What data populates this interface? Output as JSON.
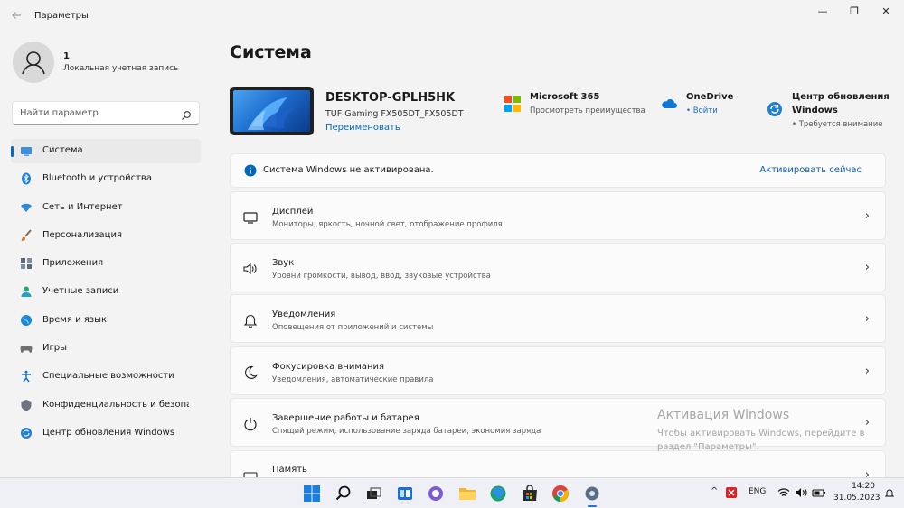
{
  "window": {
    "title": "Параметры",
    "controls": {
      "minimize": "—",
      "maximize": "❐",
      "close": "✕"
    }
  },
  "profile": {
    "name": "1",
    "account_type": "Локальная учетная запись"
  },
  "search": {
    "placeholder": "Найти параметр"
  },
  "sidebar": {
    "items": [
      {
        "label": "Система",
        "icon": "system-icon",
        "active": true
      },
      {
        "label": "Bluetooth и устройства",
        "icon": "bluetooth-icon"
      },
      {
        "label": "Сеть и Интернет",
        "icon": "wifi-icon"
      },
      {
        "label": "Персонализация",
        "icon": "brush-icon"
      },
      {
        "label": "Приложения",
        "icon": "apps-icon"
      },
      {
        "label": "Учетные записи",
        "icon": "accounts-icon"
      },
      {
        "label": "Время и язык",
        "icon": "globe-icon"
      },
      {
        "label": "Игры",
        "icon": "gamepad-icon"
      },
      {
        "label": "Специальные возможности",
        "icon": "accessibility-icon"
      },
      {
        "label": "Конфиденциальность и безопасность",
        "icon": "shield-icon"
      },
      {
        "label": "Центр обновления Windows",
        "icon": "update-icon"
      }
    ]
  },
  "main": {
    "title": "Система",
    "device": {
      "name": "DESKTOP-GPLH5HK",
      "model": "TUF Gaming FX505DT_FX505DT",
      "rename": "Переименовать"
    },
    "quick": [
      {
        "title": "Microsoft 365",
        "subtitle": "Просмотреть преимущества",
        "icon": "microsoft-365-icon"
      },
      {
        "title": "OneDrive",
        "subtitle": "• Войти",
        "icon": "onedrive-icon"
      },
      {
        "title": "Центр обновления Windows",
        "title_line1": "Центр обновления",
        "title_line2": "Windows",
        "subtitle": "• Требуется внимание",
        "icon": "windows-update-icon"
      }
    ],
    "activation": {
      "message": "Система Windows не активирована.",
      "action": "Активировать сейчас"
    },
    "settings": [
      {
        "title": "Дисплей",
        "description": "Мониторы, яркость, ночной свет, отображение профиля",
        "icon": "display-icon"
      },
      {
        "title": "Звук",
        "description": "Уровни громкости, вывод, ввод, звуковые устройства",
        "icon": "sound-icon"
      },
      {
        "title": "Уведомления",
        "description": "Оповещения от приложений и системы",
        "icon": "bell-icon"
      },
      {
        "title": "Фокусировка внимания",
        "description": "Уведомления, автоматические правила",
        "icon": "focus-icon"
      },
      {
        "title": "Завершение работы и батарея",
        "description": "Спящий режим, использование заряда батареи, экономия заряда",
        "icon": "power-icon"
      },
      {
        "title": "Память",
        "description": "",
        "icon": "storage-icon"
      }
    ]
  },
  "watermark": {
    "title": "Активация Windows",
    "line1": "Чтобы активировать Windows, перейдите в",
    "line2": "раздел \"Параметры\"."
  },
  "taskbar": {
    "apps": [
      "windows-start-icon",
      "search-icon",
      "task-view-icon",
      "widgets-icon",
      "chat-icon",
      "file-explorer-icon",
      "edge-icon",
      "store-icon",
      "chrome-icon",
      "settings-icon"
    ],
    "tray": {
      "chevron": "^",
      "language": "ENG",
      "time": "14:20",
      "date": "31.05.2023"
    }
  }
}
